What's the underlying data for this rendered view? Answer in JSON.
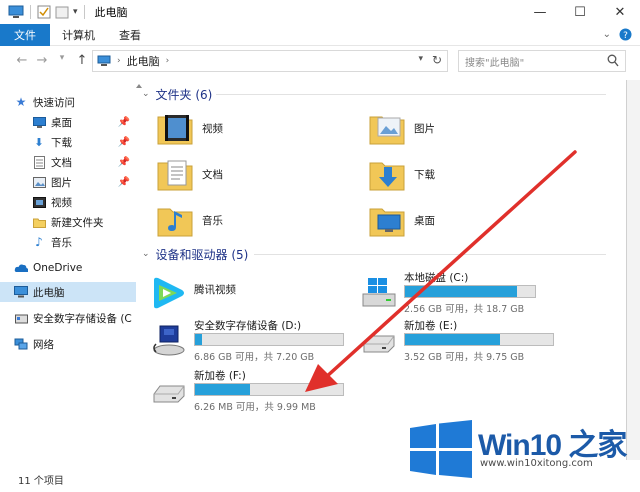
{
  "window": {
    "title": "此电脑",
    "controls": {
      "minimize": "—",
      "maximize": "☐",
      "close": "✕"
    }
  },
  "ribbon": {
    "tabs": [
      "文件",
      "计算机",
      "查看"
    ]
  },
  "address": {
    "crumb": "此电脑",
    "search_placeholder": "搜索\"此电脑\""
  },
  "sidebar": {
    "items": [
      {
        "label": "快速访问",
        "icon": "star-icon",
        "pinned": false
      },
      {
        "label": "桌面",
        "icon": "desktop-icon",
        "pinned": true
      },
      {
        "label": "下载",
        "icon": "download-icon",
        "pinned": true
      },
      {
        "label": "文档",
        "icon": "document-icon",
        "pinned": true
      },
      {
        "label": "图片",
        "icon": "picture-icon",
        "pinned": true
      },
      {
        "label": "视频",
        "icon": "video-icon",
        "pinned": false
      },
      {
        "label": "新建文件夹",
        "icon": "folder-icon",
        "pinned": false
      },
      {
        "label": "音乐",
        "icon": "music-icon",
        "pinned": false
      },
      {
        "label": "OneDrive",
        "icon": "cloud-icon",
        "pinned": false
      },
      {
        "label": "此电脑",
        "icon": "computer-icon",
        "pinned": false
      },
      {
        "label": "安全数字存储设备 (C",
        "icon": "sd-card-icon",
        "pinned": false
      },
      {
        "label": "网络",
        "icon": "network-icon",
        "pinned": false
      }
    ]
  },
  "folders_group": {
    "header": "文件夹 (6)",
    "items": [
      {
        "label": "视频",
        "icon": "video-folder-icon"
      },
      {
        "label": "图片",
        "icon": "picture-folder-icon"
      },
      {
        "label": "文档",
        "icon": "document-folder-icon"
      },
      {
        "label": "下载",
        "icon": "download-folder-icon"
      },
      {
        "label": "音乐",
        "icon": "music-folder-icon"
      },
      {
        "label": "桌面",
        "icon": "desktop-folder-icon"
      }
    ]
  },
  "drives_group": {
    "header": "设备和驱动器 (5)",
    "items": [
      {
        "name": "腾讯视频",
        "info": "",
        "used_fraction": null,
        "icon": "tencent-video-icon"
      },
      {
        "name": "本地磁盘 (C:)",
        "info": "2.56 GB 可用，共 18.7 GB",
        "used_fraction": 0.86,
        "icon": "windows-drive-icon"
      },
      {
        "name": "安全数字存储设备 (D:)",
        "info": "6.86 GB 可用，共 7.20 GB",
        "used_fraction": 0.05,
        "icon": "sd-card-drive-icon"
      },
      {
        "name": "新加卷 (E:)",
        "info": "3.52 GB 可用，共 9.75 GB",
        "used_fraction": 0.64,
        "icon": "hard-drive-icon"
      },
      {
        "name": "新加卷 (F:)",
        "info": "6.26 MB 可用，共 9.99 MB",
        "used_fraction": 0.37,
        "icon": "hard-drive-icon"
      }
    ]
  },
  "status": {
    "count": "11 个项目"
  },
  "watermark": {
    "brand": "Win10 之家",
    "url": "www.win10xitong.com"
  },
  "colors": {
    "accent": "#1979ca",
    "bar_fill": "#26a0da",
    "header_text": "#1e3287",
    "arrow": "#e0302b",
    "selected": "#cce4f7"
  }
}
